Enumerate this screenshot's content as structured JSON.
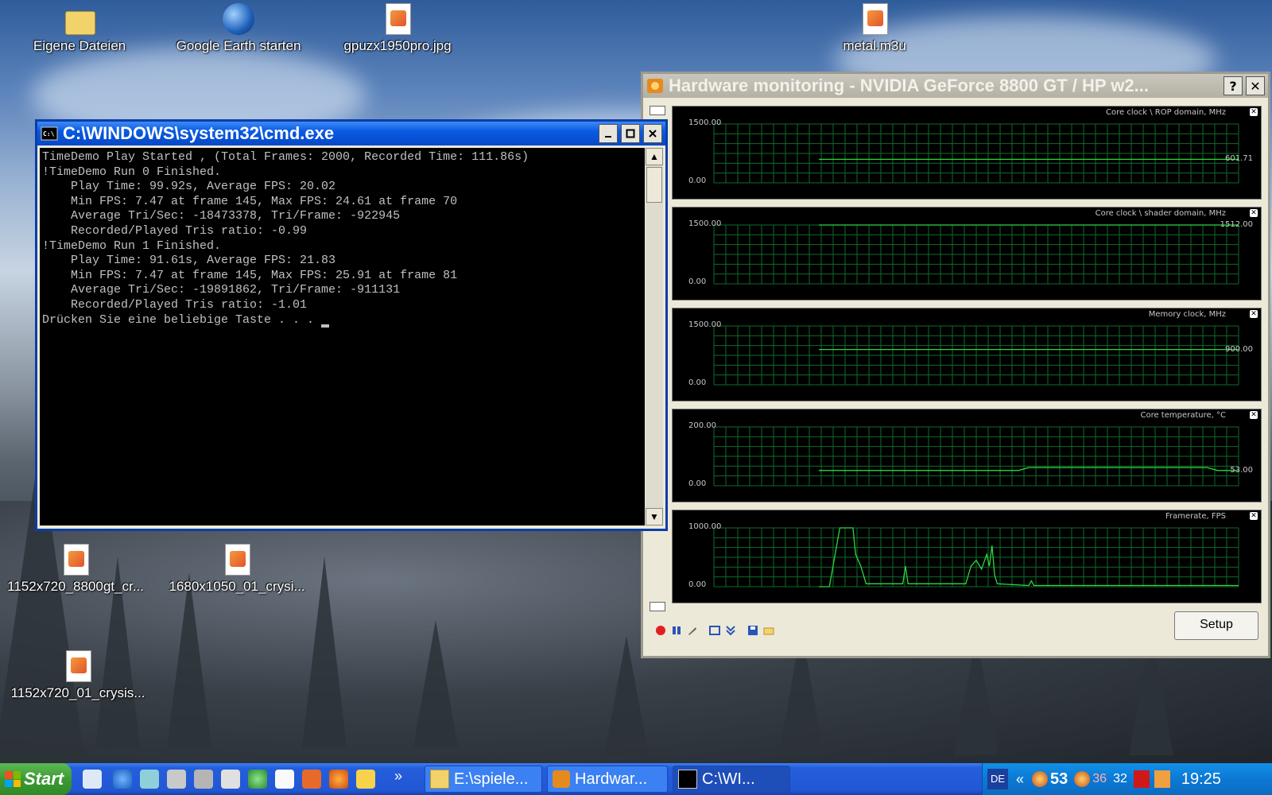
{
  "desktop": {
    "icons_top": [
      {
        "label": "Eigene Dateien",
        "icon": "folder-icon"
      },
      {
        "label": "Google Earth starten",
        "icon": "globe-icon"
      },
      {
        "label": "gpuzx1950pro.jpg",
        "icon": "image-file-icon"
      },
      {
        "label": "metal.m3u",
        "icon": "playlist-file-icon"
      }
    ],
    "icons_bottom": [
      {
        "label": "1152x720_8800gt_cr...",
        "icon": "image-file-icon"
      },
      {
        "label": "1680x1050_01_crysi...",
        "icon": "image-file-icon"
      },
      {
        "label": "1152x720_01_crysis...",
        "icon": "image-file-icon"
      }
    ]
  },
  "cmd_window": {
    "title": "C:\\WINDOWS\\system32\\cmd.exe",
    "lines": [
      "TimeDemo Play Started , (Total Frames: 2000, Recorded Time: 111.86s)",
      "!TimeDemo Run 0 Finished.",
      "    Play Time: 99.92s, Average FPS: 20.02",
      "    Min FPS: 7.47 at frame 145, Max FPS: 24.61 at frame 70",
      "    Average Tri/Sec: -18473378, Tri/Frame: -922945",
      "    Recorded/Played Tris ratio: -0.99",
      "!TimeDemo Run 1 Finished.",
      "    Play Time: 91.61s, Average FPS: 21.83",
      "    Min FPS: 7.47 at frame 145, Max FPS: 25.91 at frame 81",
      "    Average Tri/Sec: -19891862, Tri/Frame: -911131",
      "    Recorded/Played Tris ratio: -1.01",
      "Drücken Sie eine beliebige Taste . . . "
    ]
  },
  "hw_window": {
    "title": "Hardware monitoring - NVIDIA GeForce 8800 GT / HP w2...",
    "help_label": "?",
    "close_label": "✕",
    "setup_label": "Setup",
    "graphs": [
      {
        "title": "Core clock \\ ROP domain, MHz",
        "max": "1500.00",
        "min": "0.00",
        "current": "601.71",
        "start": 0.2,
        "level": 0.4
      },
      {
        "title": "Core clock \\ shader domain, MHz",
        "max": "1500.00",
        "min": "0.00",
        "current": "1512.00",
        "start": 0.2,
        "level": 1.0
      },
      {
        "title": "Memory clock, MHz",
        "max": "1500.00",
        "min": "0.00",
        "current": "900.00",
        "start": 0.2,
        "level": 0.6
      },
      {
        "title": "Core temperature, °C",
        "max": "200.00",
        "min": "0.00",
        "current": "53.00",
        "start": 0.2,
        "level": 0.26
      },
      {
        "title": "Framerate, FPS",
        "max": "1000.00",
        "min": "0.00",
        "current": "",
        "start": 0.2,
        "level": 0.0
      }
    ],
    "colors": {
      "grid": "#0f6b2a",
      "line": "#2fd63f",
      "bg": "#000000"
    }
  },
  "taskbar": {
    "start_label": "Start",
    "chevron": "»",
    "tasks": [
      {
        "label": "E:\\spiele...",
        "icon": "folder-icon",
        "active": false
      },
      {
        "label": "Hardwar...",
        "icon": "monitor-app-icon",
        "active": false
      },
      {
        "label": "C:\\WI...",
        "icon": "cmd-icon",
        "active": true
      }
    ],
    "tray": {
      "lang": "DE",
      "expand": "«",
      "temp1": "53",
      "temp2": "36",
      "temp3": "32",
      "clock": "19:25"
    }
  }
}
